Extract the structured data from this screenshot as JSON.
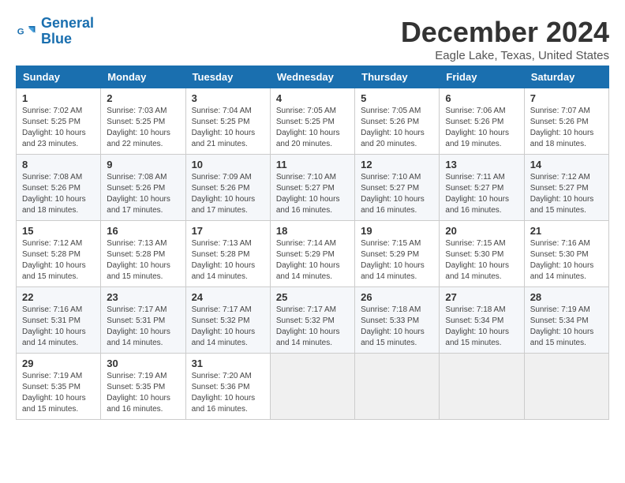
{
  "app": {
    "logo_line1": "General",
    "logo_line2": "Blue"
  },
  "header": {
    "title": "December 2024",
    "subtitle": "Eagle Lake, Texas, United States"
  },
  "calendar": {
    "days_of_week": [
      "Sunday",
      "Monday",
      "Tuesday",
      "Wednesday",
      "Thursday",
      "Friday",
      "Saturday"
    ],
    "weeks": [
      [
        {
          "day": "",
          "info": ""
        },
        {
          "day": "2",
          "info": "Sunrise: 7:03 AM\nSunset: 5:25 PM\nDaylight: 10 hours\nand 22 minutes."
        },
        {
          "day": "3",
          "info": "Sunrise: 7:04 AM\nSunset: 5:25 PM\nDaylight: 10 hours\nand 21 minutes."
        },
        {
          "day": "4",
          "info": "Sunrise: 7:05 AM\nSunset: 5:25 PM\nDaylight: 10 hours\nand 20 minutes."
        },
        {
          "day": "5",
          "info": "Sunrise: 7:05 AM\nSunset: 5:26 PM\nDaylight: 10 hours\nand 20 minutes."
        },
        {
          "day": "6",
          "info": "Sunrise: 7:06 AM\nSunset: 5:26 PM\nDaylight: 10 hours\nand 19 minutes."
        },
        {
          "day": "7",
          "info": "Sunrise: 7:07 AM\nSunset: 5:26 PM\nDaylight: 10 hours\nand 18 minutes."
        }
      ],
      [
        {
          "day": "1",
          "info": "Sunrise: 7:02 AM\nSunset: 5:25 PM\nDaylight: 10 hours\nand 23 minutes."
        },
        null,
        null,
        null,
        null,
        null,
        null
      ],
      [
        {
          "day": "8",
          "info": "Sunrise: 7:08 AM\nSunset: 5:26 PM\nDaylight: 10 hours\nand 18 minutes."
        },
        {
          "day": "9",
          "info": "Sunrise: 7:08 AM\nSunset: 5:26 PM\nDaylight: 10 hours\nand 17 minutes."
        },
        {
          "day": "10",
          "info": "Sunrise: 7:09 AM\nSunset: 5:26 PM\nDaylight: 10 hours\nand 17 minutes."
        },
        {
          "day": "11",
          "info": "Sunrise: 7:10 AM\nSunset: 5:27 PM\nDaylight: 10 hours\nand 16 minutes."
        },
        {
          "day": "12",
          "info": "Sunrise: 7:10 AM\nSunset: 5:27 PM\nDaylight: 10 hours\nand 16 minutes."
        },
        {
          "day": "13",
          "info": "Sunrise: 7:11 AM\nSunset: 5:27 PM\nDaylight: 10 hours\nand 16 minutes."
        },
        {
          "day": "14",
          "info": "Sunrise: 7:12 AM\nSunset: 5:27 PM\nDaylight: 10 hours\nand 15 minutes."
        }
      ],
      [
        {
          "day": "15",
          "info": "Sunrise: 7:12 AM\nSunset: 5:28 PM\nDaylight: 10 hours\nand 15 minutes."
        },
        {
          "day": "16",
          "info": "Sunrise: 7:13 AM\nSunset: 5:28 PM\nDaylight: 10 hours\nand 15 minutes."
        },
        {
          "day": "17",
          "info": "Sunrise: 7:13 AM\nSunset: 5:28 PM\nDaylight: 10 hours\nand 14 minutes."
        },
        {
          "day": "18",
          "info": "Sunrise: 7:14 AM\nSunset: 5:29 PM\nDaylight: 10 hours\nand 14 minutes."
        },
        {
          "day": "19",
          "info": "Sunrise: 7:15 AM\nSunset: 5:29 PM\nDaylight: 10 hours\nand 14 minutes."
        },
        {
          "day": "20",
          "info": "Sunrise: 7:15 AM\nSunset: 5:30 PM\nDaylight: 10 hours\nand 14 minutes."
        },
        {
          "day": "21",
          "info": "Sunrise: 7:16 AM\nSunset: 5:30 PM\nDaylight: 10 hours\nand 14 minutes."
        }
      ],
      [
        {
          "day": "22",
          "info": "Sunrise: 7:16 AM\nSunset: 5:31 PM\nDaylight: 10 hours\nand 14 minutes."
        },
        {
          "day": "23",
          "info": "Sunrise: 7:17 AM\nSunset: 5:31 PM\nDaylight: 10 hours\nand 14 minutes."
        },
        {
          "day": "24",
          "info": "Sunrise: 7:17 AM\nSunset: 5:32 PM\nDaylight: 10 hours\nand 14 minutes."
        },
        {
          "day": "25",
          "info": "Sunrise: 7:17 AM\nSunset: 5:32 PM\nDaylight: 10 hours\nand 14 minutes."
        },
        {
          "day": "26",
          "info": "Sunrise: 7:18 AM\nSunset: 5:33 PM\nDaylight: 10 hours\nand 15 minutes."
        },
        {
          "day": "27",
          "info": "Sunrise: 7:18 AM\nSunset: 5:34 PM\nDaylight: 10 hours\nand 15 minutes."
        },
        {
          "day": "28",
          "info": "Sunrise: 7:19 AM\nSunset: 5:34 PM\nDaylight: 10 hours\nand 15 minutes."
        }
      ],
      [
        {
          "day": "29",
          "info": "Sunrise: 7:19 AM\nSunset: 5:35 PM\nDaylight: 10 hours\nand 15 minutes."
        },
        {
          "day": "30",
          "info": "Sunrise: 7:19 AM\nSunset: 5:35 PM\nDaylight: 10 hours\nand 16 minutes."
        },
        {
          "day": "31",
          "info": "Sunrise: 7:20 AM\nSunset: 5:36 PM\nDaylight: 10 hours\nand 16 minutes."
        },
        {
          "day": "",
          "info": ""
        },
        {
          "day": "",
          "info": ""
        },
        {
          "day": "",
          "info": ""
        },
        {
          "day": "",
          "info": ""
        }
      ]
    ]
  }
}
